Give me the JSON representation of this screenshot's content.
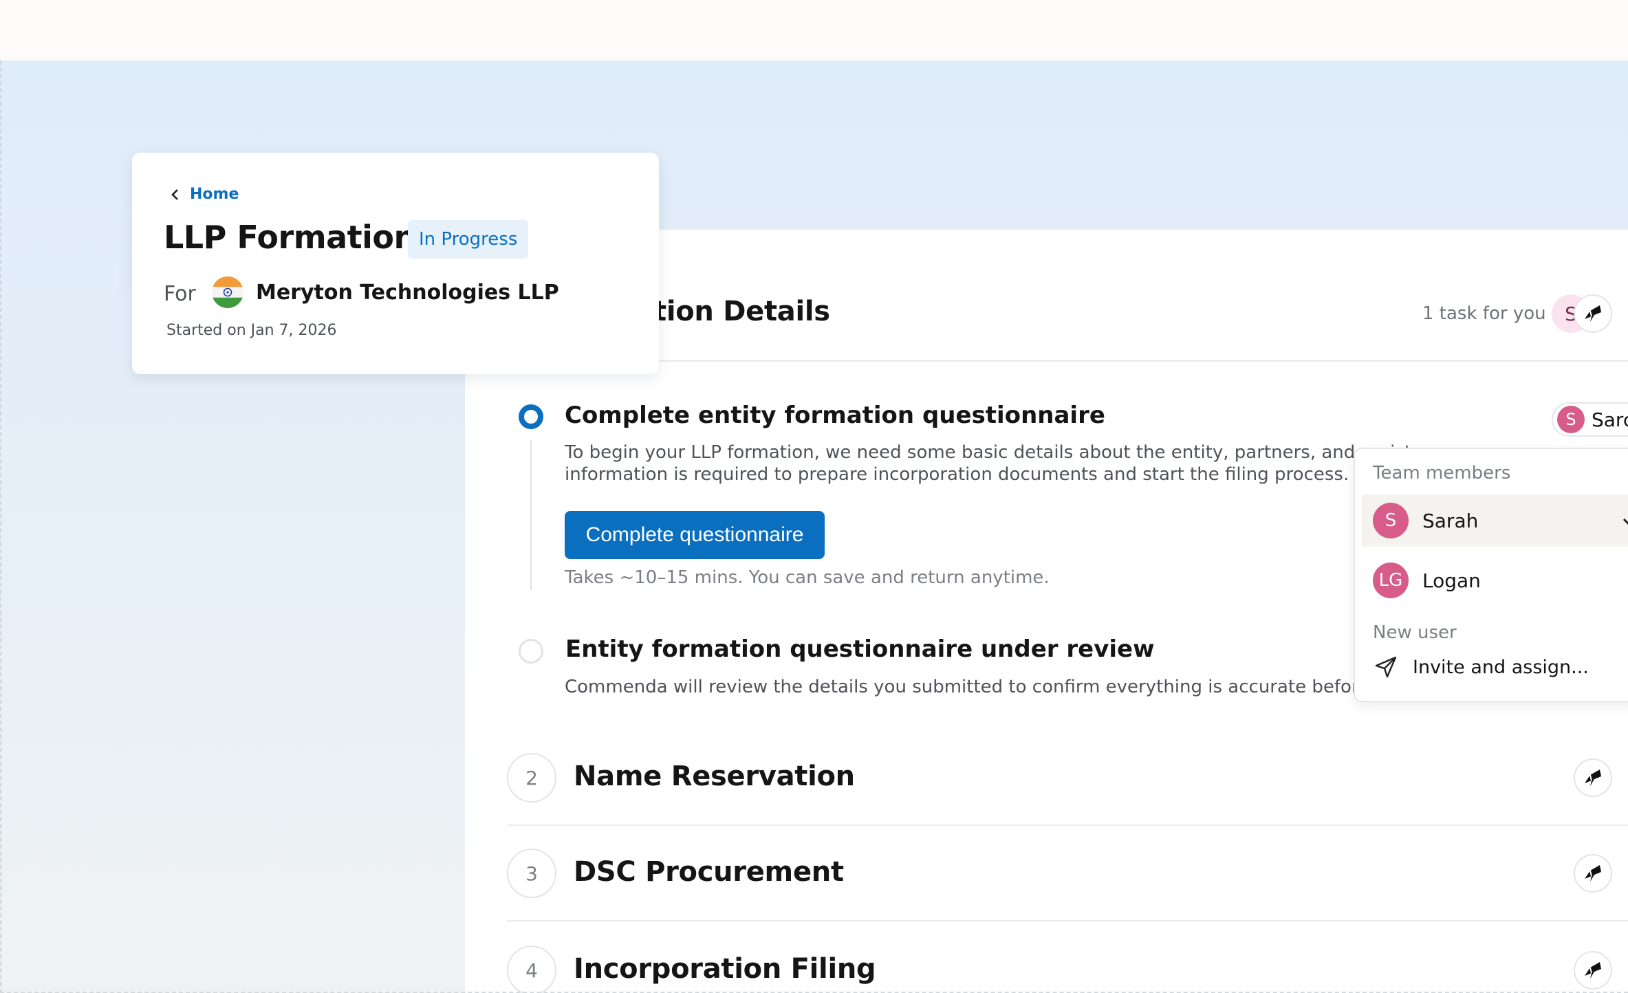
{
  "header_card": {
    "back_label": "Home",
    "title": "LLP Formation",
    "status": "In Progress",
    "for_label": "For",
    "entity_name": "Meryton Technologies LLP",
    "started": "Started on Jan 7, 2026"
  },
  "section": {
    "title_visible": "tion Details",
    "task_count": "1 task for you",
    "avatar_initial": "S"
  },
  "tasks": [
    {
      "title": "Complete entity formation questionnaire",
      "desc_line1": "To begin your LLP formation, we need some basic details about the entity, partners, and registe",
      "desc_line2": "information is required to prepare incorporation documents and start the filing process.",
      "cta": "Complete questionnaire",
      "hint": "Takes ~10–15 mins. You can save and return anytime.",
      "assignee_initial": "S",
      "assignee_name": "Sarc"
    },
    {
      "title": "Entity formation questionnaire under review",
      "desc_line1": "Commenda will review the details you submitted to confirm everything is accurate before we pr"
    }
  ],
  "dropdown": {
    "team_header": "Team members",
    "members": [
      {
        "initials": "S",
        "name": "Sarah",
        "selected": true
      },
      {
        "initials": "LG",
        "name": "Logan",
        "selected": false
      }
    ],
    "new_user_header": "New user",
    "invite_label": "Invite and assign..."
  },
  "steps": [
    {
      "number": "2",
      "title": "Name Reservation"
    },
    {
      "number": "3",
      "title": "DSC Procurement"
    },
    {
      "number": "4",
      "title": "Incorporation Filing"
    }
  ],
  "colors": {
    "primary": "#0b6fbf",
    "avatar_pink": "#d85c8a",
    "badge_bg": "#e6f1fb"
  },
  "icons": {
    "back": "chevron-left-icon",
    "assign": "assign-user-icon",
    "check": "check-icon",
    "invite": "send-icon"
  }
}
